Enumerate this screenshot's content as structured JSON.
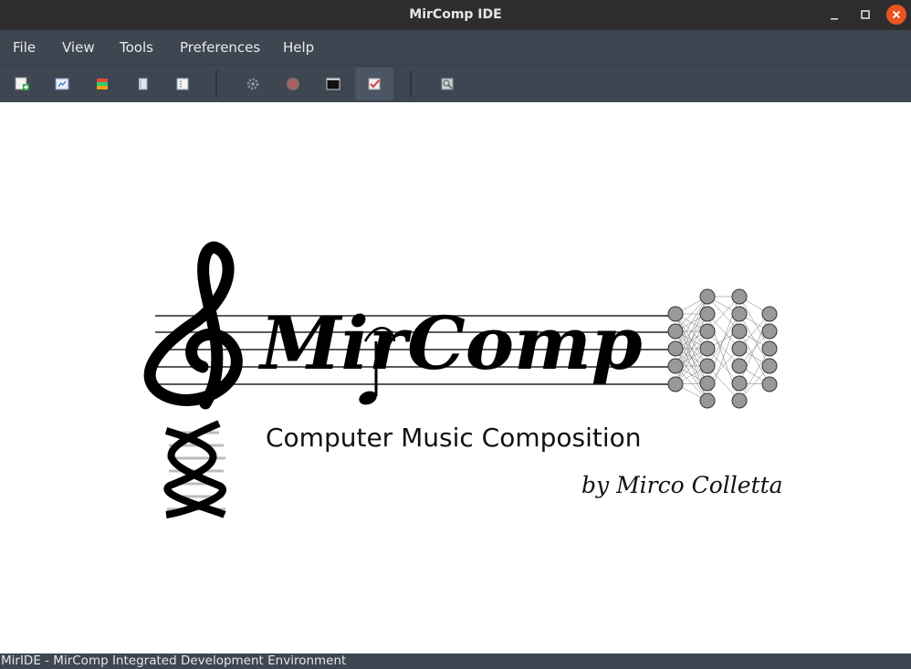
{
  "window": {
    "title": "MirComp IDE"
  },
  "menu": {
    "items": [
      "File",
      "View",
      "Tools",
      "Preferences",
      "Help"
    ]
  },
  "toolbar": {
    "buttons": [
      {
        "icon": "new-project-icon"
      },
      {
        "icon": "open-file-icon"
      },
      {
        "icon": "colored-blocks-icon"
      },
      {
        "icon": "book-icon"
      },
      {
        "icon": "document-list-icon"
      },
      {
        "icon": "gear-icon"
      },
      {
        "icon": "stop-icon"
      },
      {
        "icon": "terminal-icon"
      },
      {
        "icon": "check-list-icon",
        "active": true
      },
      {
        "icon": "zoom-image-icon"
      }
    ]
  },
  "logo": {
    "brand": "MirComp",
    "tagline": "Computer Music Composition",
    "author": "by Mirco Colletta"
  },
  "status": {
    "text": "MirIDE - MirComp Integrated Development Environment"
  },
  "colors": {
    "titlebar": "#2d2d2d",
    "menubar": "#3e4652",
    "close": "#e95420"
  }
}
